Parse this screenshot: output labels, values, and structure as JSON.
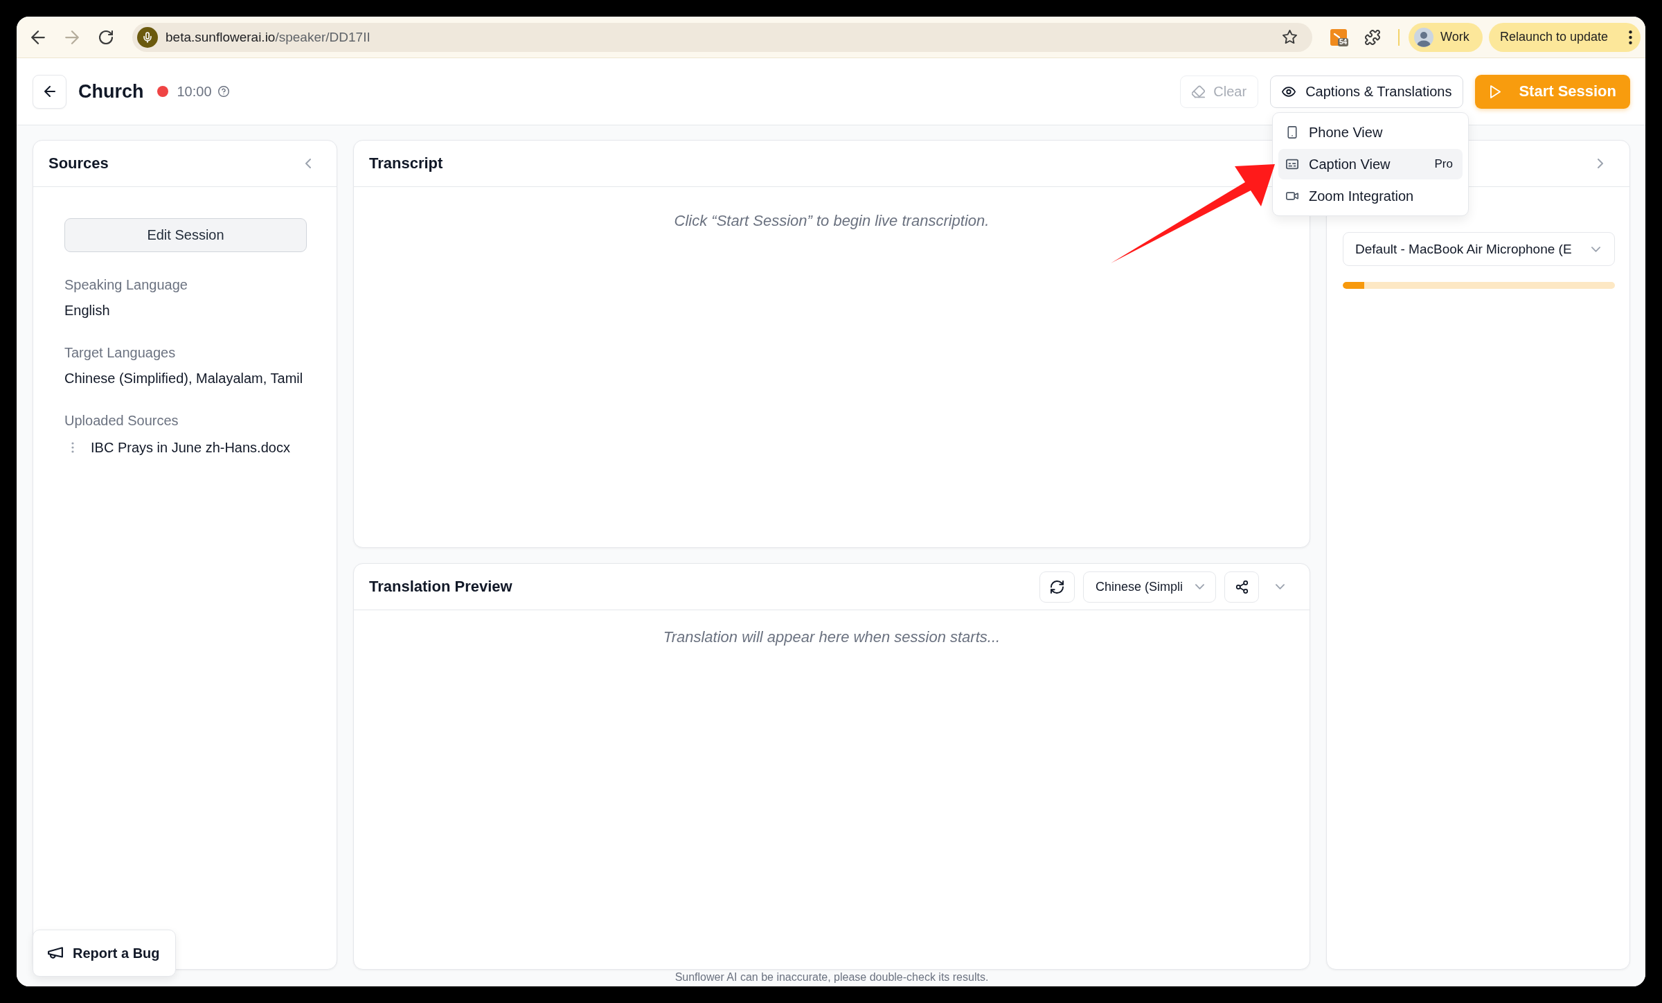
{
  "browser": {
    "nav": {
      "forward_disabled": true
    },
    "url": {
      "host": "beta.sunflowerai.io",
      "path": "/speaker/DD17II"
    },
    "extension_badge": "54",
    "profile": "Work",
    "update_button": "Relaunch to update"
  },
  "header": {
    "title": "Church",
    "recording": true,
    "timer": "10:00",
    "clear_button": {
      "label": "Clear",
      "disabled": true
    },
    "captions_button": {
      "label": "Captions & Translations",
      "expanded": true
    },
    "start_button": {
      "label": "Start Session"
    }
  },
  "captions_menu": {
    "items": [
      {
        "kind": "phone",
        "label": "Phone View",
        "selected": false
      },
      {
        "kind": "caption",
        "label": "Caption View",
        "badge": "Pro",
        "selected": true
      },
      {
        "kind": "zoom",
        "label": "Zoom Integration",
        "selected": false
      }
    ]
  },
  "sources_panel": {
    "title": "Sources",
    "edit_button": "Edit Session",
    "fields": [
      {
        "label": "Speaking Language",
        "value": "English"
      },
      {
        "label": "Target Languages",
        "value": "Chinese (Simplified), Malayalam, Tamil"
      }
    ],
    "uploaded_sources": {
      "label": "Uploaded Sources",
      "files": [
        "IBC Prays in June zh-Hans.docx"
      ]
    }
  },
  "transcript_panel": {
    "title": "Transcript",
    "empty_message": "Click “Start Session” to begin live transcription."
  },
  "translation_panel": {
    "title": "Translation Preview",
    "language": "Chinese (Simpli",
    "empty_message": "Translation will appear here when session starts..."
  },
  "audio_panel": {
    "device": "Default - MacBook Air Microphone (E",
    "level": 0.08
  },
  "report_button": "Report a Bug",
  "footer": "Sunflower AI can be inaccurate, please double-check its results."
}
